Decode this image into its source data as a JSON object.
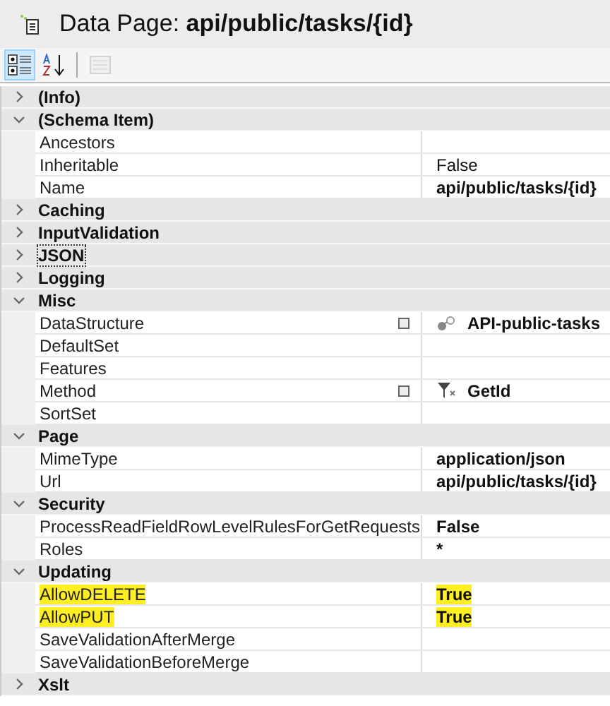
{
  "header": {
    "label": "Data Page:",
    "name": "api/public/tasks/{id}"
  },
  "toolbar": [
    {
      "kind": "categorized",
      "selected": true,
      "disabled": false
    },
    {
      "kind": "alphabetical",
      "selected": false,
      "disabled": false
    },
    {
      "kind": "pages",
      "selected": false,
      "disabled": true
    }
  ],
  "categories": [
    {
      "label": "(Info)",
      "expanded": false,
      "focused": false
    },
    {
      "label": "(Schema Item)",
      "expanded": true,
      "focused": false,
      "properties": [
        {
          "kind": "plain",
          "name": "Ancestors",
          "highlighted": false
        },
        {
          "kind": "plain",
          "name": "Inheritable",
          "value": "False",
          "modified": false,
          "highlighted": false
        },
        {
          "kind": "plain",
          "name": "Name",
          "value": "api/public/tasks/{id}",
          "modified": true,
          "highlighted": false
        }
      ]
    },
    {
      "label": "Caching",
      "expanded": false,
      "focused": false
    },
    {
      "label": "InputValidation",
      "expanded": false,
      "focused": false
    },
    {
      "label": "JSON",
      "expanded": false,
      "focused": true
    },
    {
      "label": "Logging",
      "expanded": false,
      "focused": false
    },
    {
      "label": "Misc",
      "expanded": true,
      "focused": false,
      "properties": [
        {
          "kind": "link",
          "name": "DataStructure",
          "value": "API-public-tasks",
          "modified": true,
          "highlighted": false,
          "editor_button": true
        },
        {
          "kind": "plain",
          "name": "DefaultSet",
          "highlighted": false
        },
        {
          "kind": "plain",
          "name": "Features",
          "highlighted": false
        },
        {
          "kind": "filter",
          "name": "Method",
          "value": "GetId",
          "modified": true,
          "highlighted": false,
          "editor_button": true
        },
        {
          "kind": "plain",
          "name": "SortSet",
          "highlighted": false
        }
      ]
    },
    {
      "label": "Page",
      "expanded": true,
      "focused": false,
      "properties": [
        {
          "kind": "plain",
          "name": "MimeType",
          "value": "application/json",
          "modified": true,
          "highlighted": false
        },
        {
          "kind": "plain",
          "name": "Url",
          "value": "api/public/tasks/{id}",
          "modified": true,
          "highlighted": false
        }
      ]
    },
    {
      "label": "Security",
      "expanded": true,
      "focused": false,
      "properties": [
        {
          "kind": "plain",
          "name": "ProcessReadFieldRowLevelRulesForGetRequests",
          "value": "False",
          "modified": true,
          "highlighted": false
        },
        {
          "kind": "plain",
          "name": "Roles",
          "value": "*",
          "modified": true,
          "highlighted": false
        }
      ]
    },
    {
      "label": "Updating",
      "expanded": true,
      "focused": false,
      "properties": [
        {
          "kind": "plain",
          "name": "AllowDELETE",
          "value": "True",
          "modified": true,
          "highlighted": true
        },
        {
          "kind": "plain",
          "name": "AllowPUT",
          "value": "True",
          "modified": true,
          "highlighted": true
        },
        {
          "kind": "plain",
          "name": "SaveValidationAfterMerge",
          "highlighted": false
        },
        {
          "kind": "plain",
          "name": "SaveValidationBeforeMerge",
          "highlighted": false
        }
      ]
    },
    {
      "label": "Xslt",
      "expanded": false,
      "focused": false
    }
  ]
}
